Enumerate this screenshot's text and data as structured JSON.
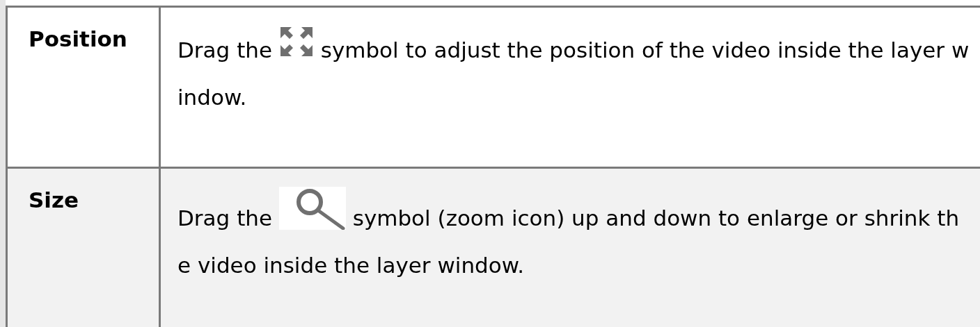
{
  "table": {
    "rows": [
      {
        "label": "Position",
        "text_before": "Drag the",
        "kind": "move",
        "text_after": "symbol to adjust the position of the video inside the layer window.",
        "shaded": false
      },
      {
        "label": "Size",
        "text_before": "Drag the",
        "kind": "zoom",
        "text_after": "symbol (zoom icon) up and down to enlarge or shrink the video inside the layer window.",
        "shaded": true
      }
    ]
  }
}
